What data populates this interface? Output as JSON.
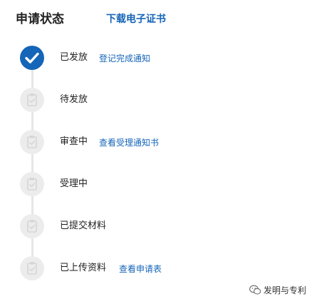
{
  "header": {
    "title": "申请状态",
    "download_link": "下载电子证书"
  },
  "steps": [
    {
      "status": "已发放",
      "link": "登记完成通知",
      "state": "done",
      "icon": "checkmark-icon"
    },
    {
      "status": "待发放",
      "link": "",
      "state": "pending",
      "icon": "clipboard-icon"
    },
    {
      "status": "审查中",
      "link": "查看受理通知书",
      "state": "pending",
      "icon": "clipboard-icon"
    },
    {
      "status": "受理中",
      "link": "",
      "state": "pending",
      "icon": "clipboard-icon"
    },
    {
      "status": "已提交材料",
      "link": "",
      "state": "pending",
      "icon": "clipboard-icon"
    },
    {
      "status": "已上传资料",
      "link": "查看申请表",
      "state": "pending",
      "icon": "clipboard-icon"
    }
  ],
  "watermark": {
    "icon": "wechat-icon",
    "text": "发明与专利"
  },
  "colors": {
    "accent": "#1565b8",
    "inactive_circle": "#ececec",
    "line": "#e6e6e6"
  }
}
